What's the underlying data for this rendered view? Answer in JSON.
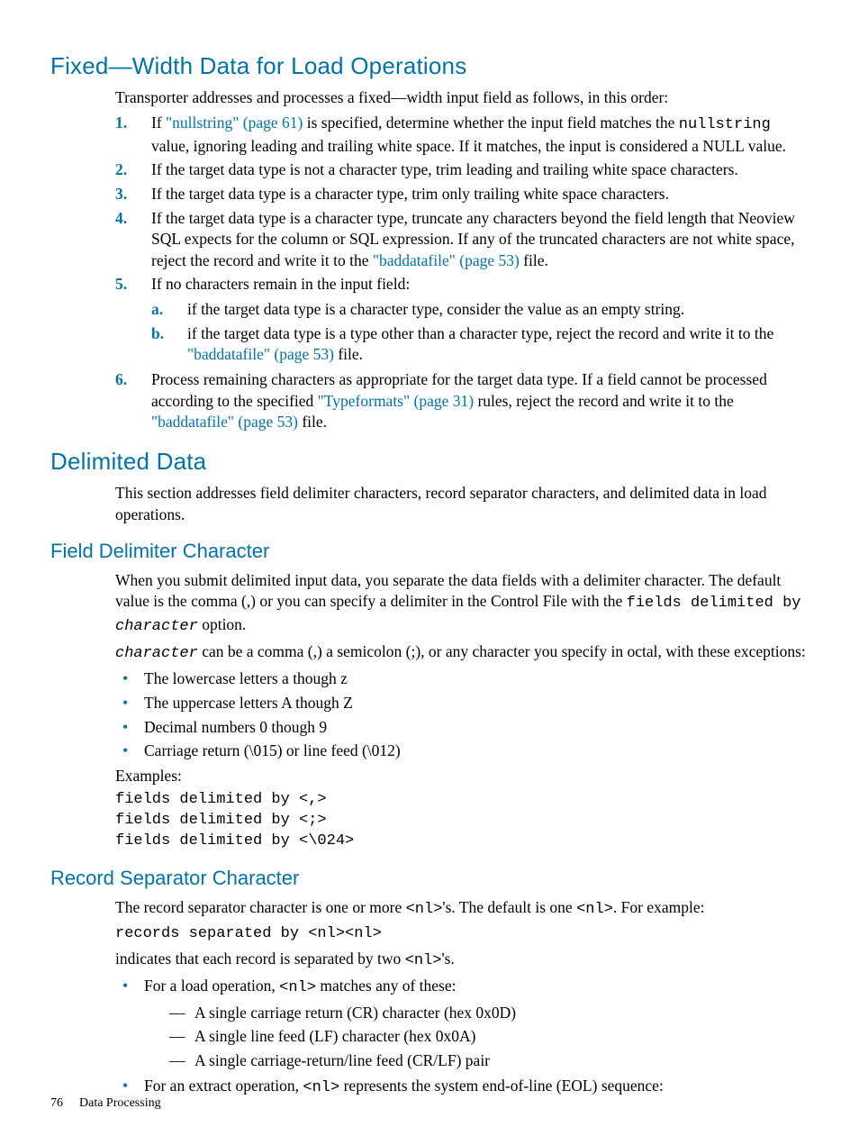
{
  "h_fixed": "Fixed—Width Data for Load Operations",
  "fixed_intro": "Transporter addresses and processes a fixed—width input field as follows, in this order:",
  "num": [
    {
      "m": "1.",
      "pre": "If ",
      "link": "\"nullstring\" (page 61)",
      "post": " is specified, determine whether the input field matches the ",
      "code": "nullstring",
      "tail": " value, ignoring leading and trailing white space. If it matches, the input is considered a NULL value."
    },
    {
      "m": "2.",
      "text": "If the target data type is not a character type, trim leading and trailing white space characters."
    },
    {
      "m": "3.",
      "text": "If the target data type is a character type, trim only trailing white space characters."
    },
    {
      "m": "4.",
      "pre": "If the target data type is a character type, truncate any characters beyond the field length that Neoview SQL expects for the column or SQL expression. If any of the truncated characters are not white space, reject the record and write it to the ",
      "link": "\"baddatafile\" (page 53)",
      "post": " file."
    },
    {
      "m": "5.",
      "text": "If no characters remain in the input field:"
    }
  ],
  "alpha": [
    {
      "m": "a.",
      "text": "if the target data type is a character type, consider the value as an empty string."
    },
    {
      "m": "b.",
      "pre": "if the target data type is a type other than a character type, reject the record and write it to the ",
      "link": "\"baddatafile\" (page 53)",
      "post": " file."
    }
  ],
  "num6": {
    "m": "6.",
    "pre": "Process remaining characters as appropriate for the target data type. If a field cannot be processed according to the specified ",
    "link": "\"Typeformats\" (page 31)",
    "mid": " rules, reject the record and write it to the ",
    "link2": "\"baddatafile\" (page 53)",
    "post": " file."
  },
  "h_delim": "Delimited Data",
  "delim_intro": "This section addresses field delimiter characters, record separator characters, and delimited data in load operations.",
  "h_field": "Field Delimiter Character",
  "field_p1_pre": "When you submit delimited input data, you separate the data fields with a delimiter character. The default value is the comma (,) or you can specify a delimiter in the Control File with the ",
  "field_p1_code": "fields delimited by ",
  "field_p1_ital": "character",
  "field_p1_tail": " option.",
  "field_p2_ital": "character",
  "field_p2_tail": " can be a comma (,) a semicolon (;), or any character you specify in octal, with these exceptions:",
  "field_bullets": [
    "The lowercase letters a though z",
    "The uppercase letters A though Z",
    "Decimal numbers 0 though 9",
    "Carriage return (\\015) or line feed (\\012)"
  ],
  "examples_label": "Examples:",
  "examples_code": "fields delimited by <,>\nfields delimited by <;>\nfields delimited by <\\024>",
  "h_record": "Record Separator Character",
  "rec_p1_a": "The record separator character is one or more ",
  "nl": "<nl>",
  "rec_p1_b": "'s. The default is one ",
  "rec_p1_c": ". For example:",
  "rec_code": "records separated by <nl><nl>",
  "rec_p2_a": "indicates that each record is separated by two ",
  "rec_p2_b": "'s.",
  "rec_b1_a": "For a load operation, ",
  "rec_b1_b": " matches any of these:",
  "rec_dashes": [
    "A single carriage return (CR) character (hex 0x0D)",
    "A single line feed (LF) character (hex 0x0A)",
    "A single carriage-return/line feed (CR/LF) pair"
  ],
  "rec_b2_a": "For an extract operation, ",
  "rec_b2_b": " represents the system end-of-line (EOL) sequence:",
  "footer_page": "76",
  "footer_title": "Data Processing"
}
